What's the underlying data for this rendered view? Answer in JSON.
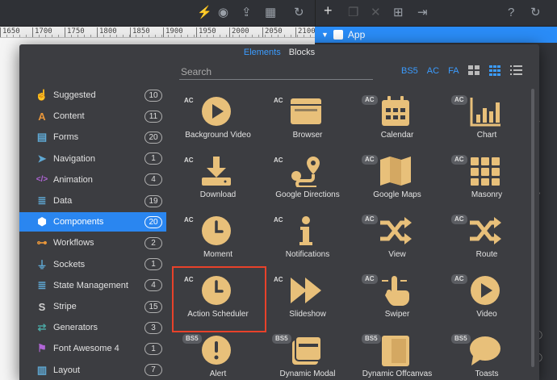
{
  "app_tree": {
    "selected_item": "App"
  },
  "ruler": {
    "ticks": [
      "1650",
      "1700",
      "1750",
      "1800",
      "1850",
      "1900",
      "1950",
      "2000",
      "2050",
      "2100"
    ]
  },
  "modal": {
    "tabs": [
      {
        "label": "Elements",
        "active": true
      },
      {
        "label": "Blocks",
        "active": false
      }
    ],
    "search_placeholder": "Search",
    "filters": [
      "BS5",
      "AC",
      "FA"
    ],
    "view_modes": [
      "large-grid",
      "small-grid",
      "list"
    ],
    "active_view_mode": "small-grid"
  },
  "categories": [
    {
      "label": "Suggested",
      "count": "10",
      "icon": "hand-pointer-icon",
      "color": "#5fa8d3"
    },
    {
      "label": "Content",
      "count": "11",
      "icon": "font-a-icon",
      "color": "#e8963a"
    },
    {
      "label": "Forms",
      "count": "20",
      "icon": "form-document-icon",
      "color": "#5fa8d3"
    },
    {
      "label": "Navigation",
      "count": "1",
      "icon": "navigation-icon",
      "color": "#5fa8d3"
    },
    {
      "label": "Animation",
      "count": "4",
      "icon": "code-icon",
      "color": "#b065d6"
    },
    {
      "label": "Data",
      "count": "19",
      "icon": "database-icon",
      "color": "#5fa8d3"
    },
    {
      "label": "Components",
      "count": "20",
      "icon": "cube-icon",
      "color": "#ffffff",
      "active": true
    },
    {
      "label": "Workflows",
      "count": "2",
      "icon": "sitemap-icon",
      "color": "#e8963a"
    },
    {
      "label": "Sockets",
      "count": "1",
      "icon": "plug-icon",
      "color": "#5fa8d3"
    },
    {
      "label": "State Management",
      "count": "4",
      "icon": "database-stack-icon",
      "color": "#5fa8d3"
    },
    {
      "label": "Stripe",
      "count": "15",
      "icon": "stripe-s-icon",
      "color": "#cfcfcf"
    },
    {
      "label": "Generators",
      "count": "3",
      "icon": "repeat-arrows-icon",
      "color": "#4aa3a0"
    },
    {
      "label": "Font Awesome 4",
      "count": "1",
      "icon": "flag-icon",
      "color": "#b065d6"
    },
    {
      "label": "Layout",
      "count": "7",
      "icon": "layout-icon",
      "color": "#5fa8d3"
    }
  ],
  "components": [
    {
      "name": "Background Video",
      "badge": "AC",
      "icon": "play-circle-icon"
    },
    {
      "name": "Browser",
      "badge": "AC",
      "icon": "browser-window-icon"
    },
    {
      "name": "Calendar",
      "badge": "AC",
      "icon": "calendar-icon"
    },
    {
      "name": "Chart",
      "badge": "AC",
      "icon": "bar-chart-icon"
    },
    {
      "name": "Download",
      "badge": "AC",
      "icon": "download-icon"
    },
    {
      "name": "Google Directions",
      "badge": "AC",
      "icon": "route-pin-icon"
    },
    {
      "name": "Google Maps",
      "badge": "AC",
      "icon": "folded-map-icon"
    },
    {
      "name": "Masonry",
      "badge": "AC",
      "icon": "masonry-grid-icon"
    },
    {
      "name": "Moment",
      "badge": "AC",
      "icon": "clock-icon"
    },
    {
      "name": "Notifications",
      "badge": "AC",
      "icon": "info-icon"
    },
    {
      "name": "View",
      "badge": "AC",
      "icon": "shuffle-icon"
    },
    {
      "name": "Route",
      "badge": "AC",
      "icon": "shuffle-icon"
    },
    {
      "name": "Action Scheduler",
      "badge": "AC",
      "icon": "clock-icon",
      "highlighted": true
    },
    {
      "name": "Slideshow",
      "badge": "AC",
      "icon": "fast-forward-icon"
    },
    {
      "name": "Swiper",
      "badge": "AC",
      "icon": "swipe-hand-icon"
    },
    {
      "name": "Video",
      "badge": "AC",
      "icon": "play-circle-icon"
    },
    {
      "name": "Alert",
      "badge": "BS5",
      "icon": "alert-circle-icon"
    },
    {
      "name": "Dynamic Modal",
      "badge": "BS5",
      "icon": "modal-window-icon"
    },
    {
      "name": "Dynamic Offcanvas",
      "badge": "BS5",
      "icon": "offcanvas-panel-icon"
    },
    {
      "name": "Toasts",
      "badge": "BS5",
      "icon": "speech-bubble-icon"
    }
  ],
  "colors": {
    "accent": "#2a86f0",
    "icon_gold": "#e8c07a",
    "highlight": "#e8422a",
    "panel": "#3c3d41"
  }
}
